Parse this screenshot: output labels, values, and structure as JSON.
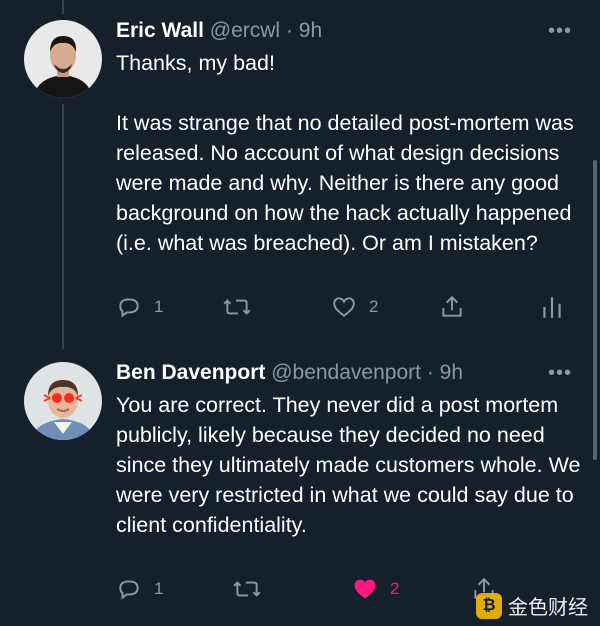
{
  "tweets": [
    {
      "name": "Eric Wall",
      "handle": "@ercwl",
      "time": "· 9h",
      "more": "•••",
      "paragraphs": [
        "Thanks, my bad!",
        "It was strange that no detailed post-mortem was released. No account of what design decisions were made and why. Neither is there any good background on how the hack actually happened (i.e. what was breached). Or am I mistaken?"
      ],
      "actions": {
        "replies": "1",
        "retweets": "",
        "likes": "2",
        "liked": false
      }
    },
    {
      "name": "Ben Davenport",
      "handle": "@bendavenport",
      "time": "· 9h",
      "more": "•••",
      "paragraphs": [
        "You are correct. They never did a post mortem publicly, likely because they decided no need since they ultimately made customers whole. We were very restricted in what we could say due to client confidentiality."
      ],
      "actions": {
        "replies": "1",
        "retweets": "",
        "likes": "2",
        "liked": true
      }
    }
  ],
  "icons": {
    "reply": "reply-icon",
    "retweet": "retweet-icon",
    "like": "heart-icon",
    "share": "share-icon",
    "analytics": "analytics-icon"
  },
  "colors": {
    "background": "#15202b",
    "secondary_text": "#8b98a5",
    "like_active": "#f91880"
  },
  "watermark": {
    "text": "金色财经"
  }
}
